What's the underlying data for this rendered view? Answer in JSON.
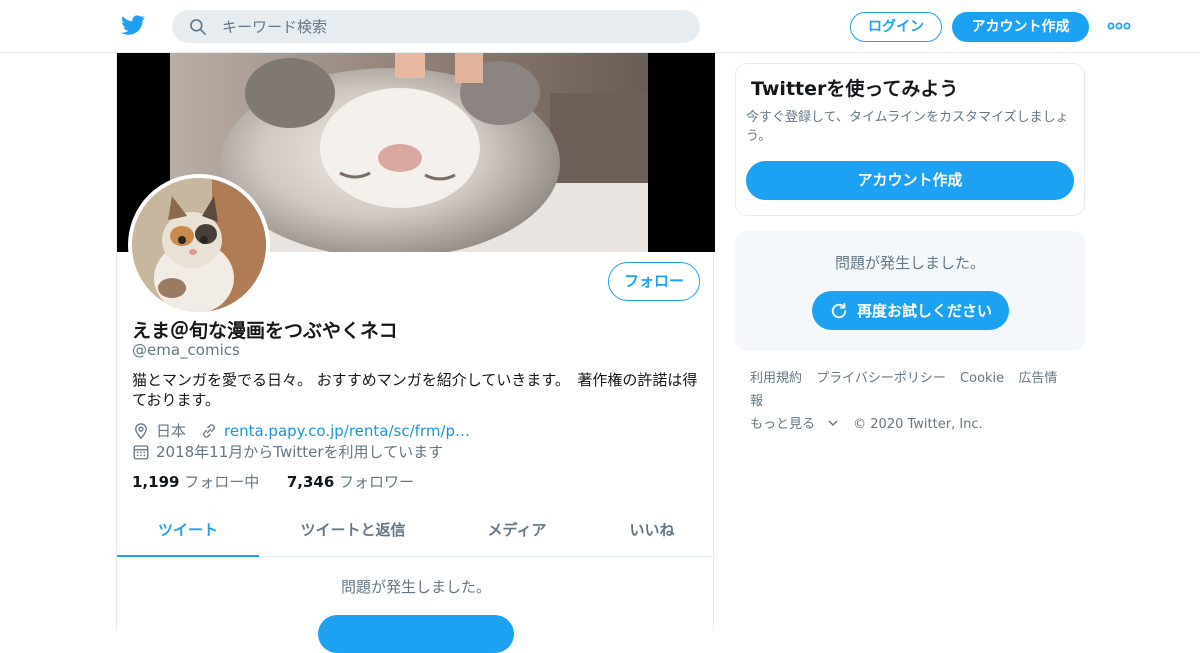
{
  "header": {
    "search_placeholder": "キーワード検索",
    "login_label": "ログイン",
    "signup_label": "アカウント作成",
    "brand_color": "#1da1f2"
  },
  "profile": {
    "name": "えま＠旬な漫画をつぶやくネコ",
    "handle": "@ema_comics",
    "bio": "猫とマンガを愛でる日々。 おすすめマンガを紹介していきます。　著作権の許諾は得ております。",
    "location": "日本",
    "link": "renta.papy.co.jp/renta/sc/frm/p…",
    "joined": "2018年11月からTwitterを利用しています",
    "following_count": "1,199",
    "following_label": "フォロー中",
    "followers_count": "7,346",
    "followers_label": "フォロワー",
    "follow_label": "フォロー"
  },
  "tabs": [
    {
      "label": "ツイート",
      "active": true
    },
    {
      "label": "ツイートと返信",
      "active": false
    },
    {
      "label": "メディア",
      "active": false
    },
    {
      "label": "いいね",
      "active": false
    }
  ],
  "timeline": {
    "error_text": "問題が発生しました。"
  },
  "sidebar": {
    "signup_card": {
      "title": "Twitterを使ってみよう",
      "text": "今すぐ登録して、タイムラインをカスタマイズしましょう。",
      "button": "アカウント作成"
    },
    "error_card": {
      "text": "問題が発生しました。",
      "retry_label": "再度お試しください"
    },
    "footer": {
      "links": [
        "利用規約",
        "プライバシーポリシー",
        "Cookie",
        "広告情報"
      ],
      "more": "もっと見る",
      "copyright": "© 2020 Twitter, Inc."
    }
  },
  "icons": [
    "twitter-bird-icon",
    "search-icon",
    "more-dots-icon",
    "location-pin-icon",
    "link-icon",
    "calendar-icon",
    "refresh-icon",
    "chevron-down-icon"
  ]
}
